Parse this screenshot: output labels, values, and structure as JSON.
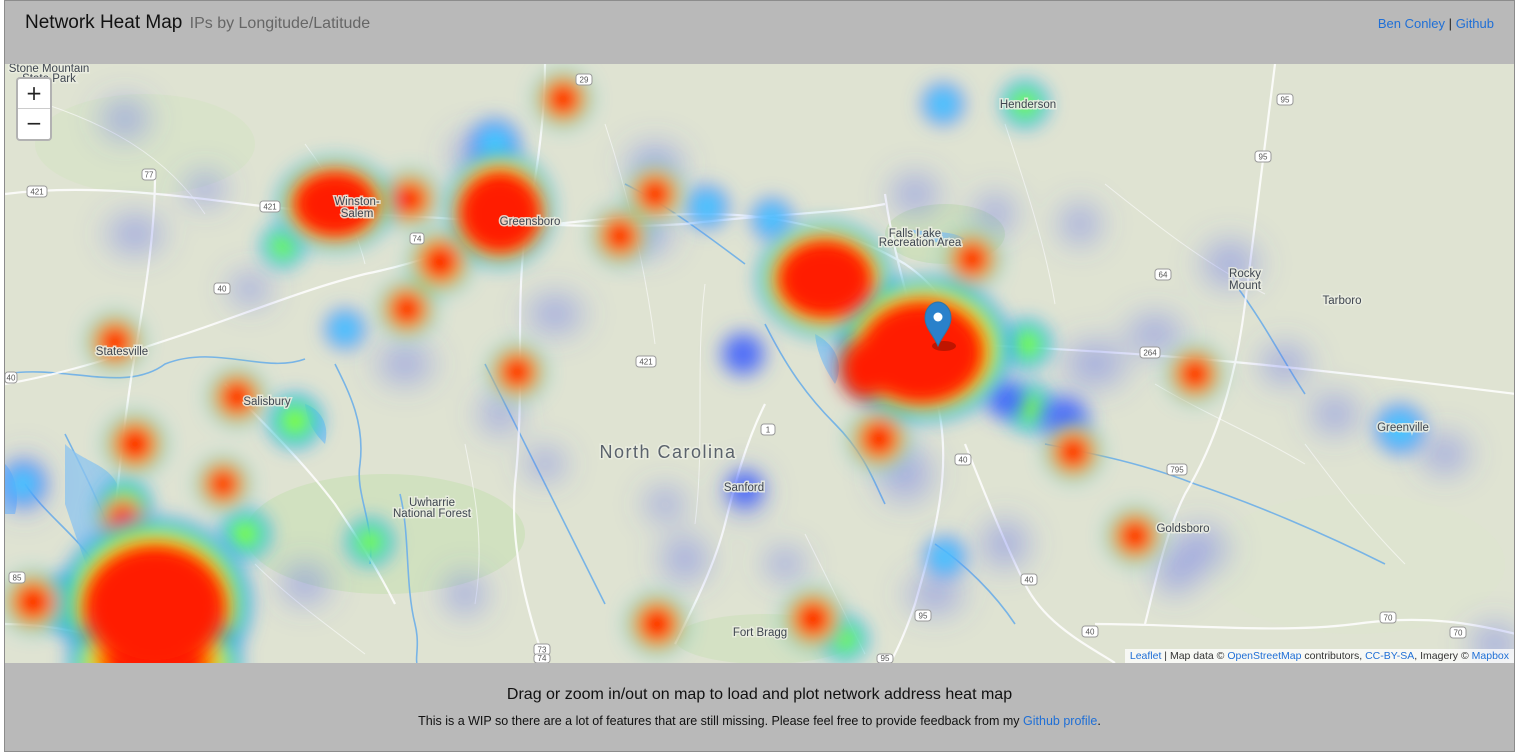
{
  "header": {
    "title": "Network Heat Map",
    "subtitle": "IPs by Longitude/Latitude",
    "author_link": "Ben Conley",
    "separator": "|",
    "github_link": "Github"
  },
  "map": {
    "zoom_in": "+",
    "zoom_out": "−",
    "state_label": "North Carolina",
    "places": [
      "Henderson",
      "Falls Lake",
      "Recreation Area",
      "Rocky",
      "Mount",
      "Tarboro",
      "Greenville",
      "Sanford",
      "Goldsboro",
      "Fort Bragg",
      "Uwharrie",
      "National Forest",
      "Statesville",
      "Salisbury",
      "Winston-",
      "Salem",
      "Greensboro",
      "Stone Mountain",
      "State Park"
    ],
    "highway_shields": [
      "77",
      "421",
      "421",
      "74",
      "40",
      "421",
      "29",
      "95",
      "95",
      "64",
      "264",
      "1",
      "40",
      "795",
      "40",
      "95",
      "73",
      "74",
      "40",
      "70",
      "70",
      "85",
      "95",
      "40",
      "40"
    ],
    "marker_icon": "map-marker-icon",
    "attribution": {
      "leaflet": "Leaflet",
      "sep1": " | Map data © ",
      "osm": "OpenStreetMap",
      "contrib": " contributors, ",
      "license": "CC-BY-SA",
      "imagery": ", Imagery © ",
      "mapbox": "Mapbox"
    },
    "heat_palette": [
      "#0000ff",
      "#00ffff",
      "#00ff00",
      "#ffff00",
      "#ff0000"
    ]
  },
  "footer": {
    "heading": "Drag or zoom in/out on map to load and plot network address heat map",
    "note": "This is a WIP so there are a lot of features that are still missing. Please feel free to provide feedback from my ",
    "note_link": "Github profile",
    "note_end": "."
  }
}
